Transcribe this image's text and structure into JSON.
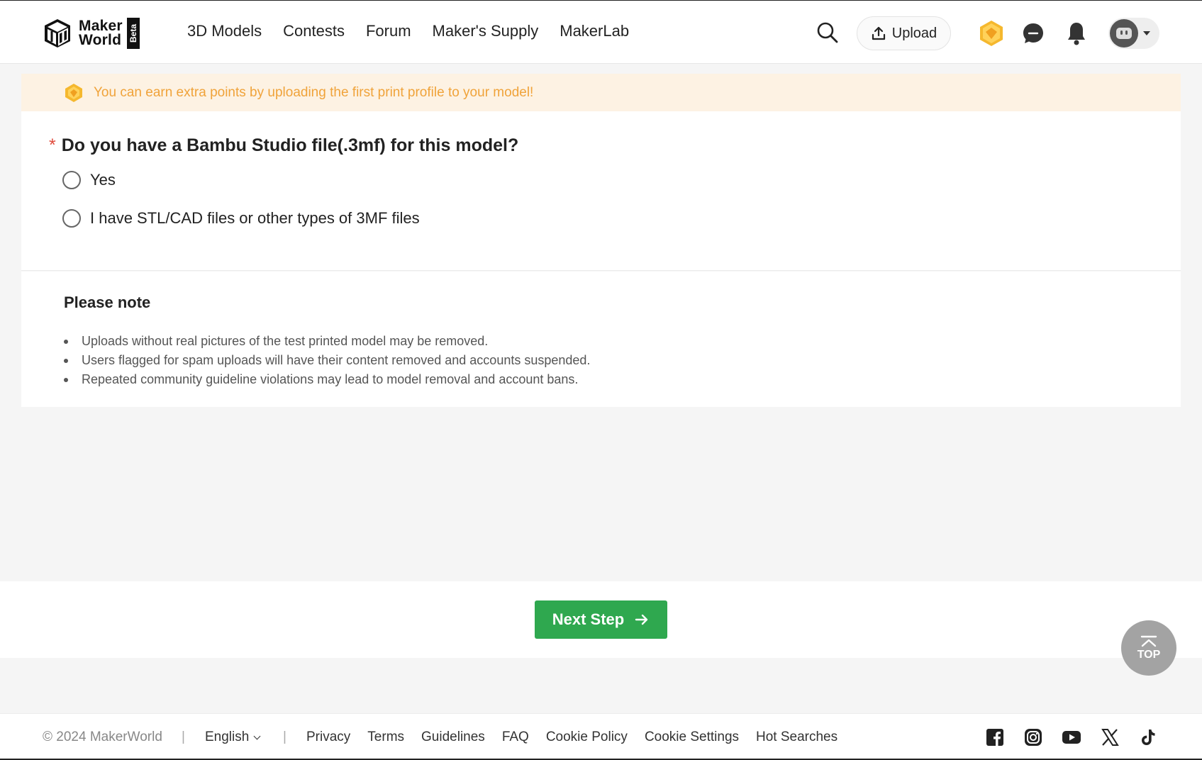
{
  "header": {
    "logo": {
      "line1": "Maker",
      "line2": "World",
      "badge": "Beta"
    },
    "nav": [
      "3D Models",
      "Contests",
      "Forum",
      "Maker's Supply",
      "MakerLab"
    ],
    "upload_label": "Upload"
  },
  "banner": {
    "text": "You can earn extra points by uploading the first print profile to your model!"
  },
  "question": {
    "required_mark": "*",
    "title": "Do you have a Bambu Studio file(.3mf) for this model?",
    "options": [
      "Yes",
      "I have STL/CAD files or other types of 3MF files"
    ]
  },
  "note": {
    "title": "Please note",
    "items": [
      "Uploads without real pictures of the test printed model may be removed.",
      "Users flagged for spam uploads will have their content removed and accounts suspended.",
      "Repeated community guideline violations may lead to model removal and account bans."
    ]
  },
  "actions": {
    "next_label": "Next Step",
    "top_label": "TOP"
  },
  "footer": {
    "copyright": "© 2024 MakerWorld",
    "separator": "|",
    "language": "English",
    "links": [
      "Privacy",
      "Terms",
      "Guidelines",
      "FAQ",
      "Cookie Policy",
      "Cookie Settings",
      "Hot Searches"
    ]
  },
  "colors": {
    "accent_green": "#2fa84f",
    "banner_bg": "#fdf2e3",
    "banner_text": "#f0a33a",
    "required_red": "#e04b3d"
  }
}
